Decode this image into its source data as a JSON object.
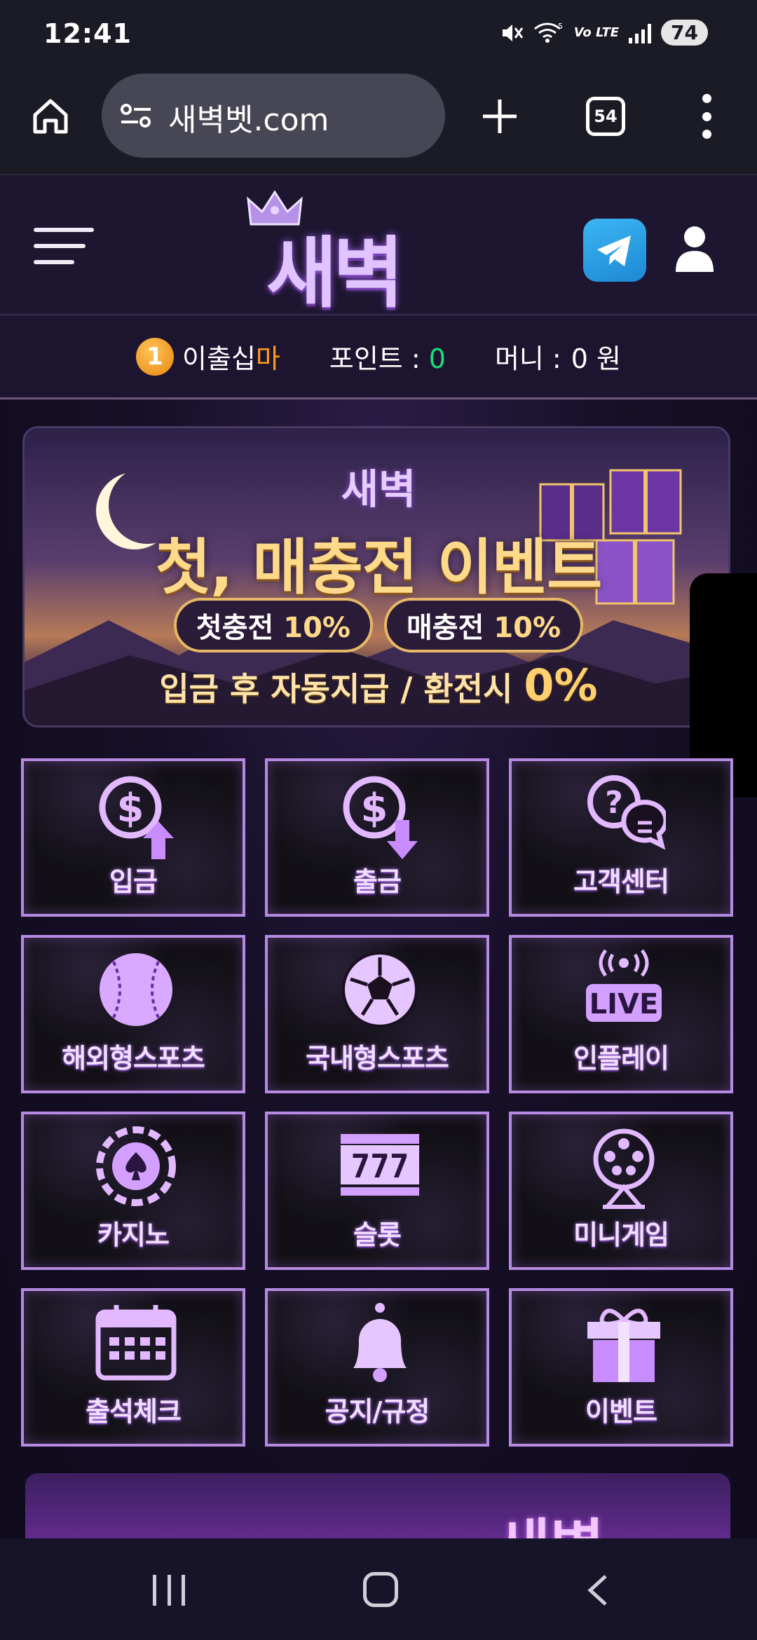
{
  "status_bar": {
    "time": "12:41",
    "wifi_label": "5",
    "volte_label": "Vo LTE",
    "battery": "74",
    "icons": [
      "mute-icon",
      "wifi-icon",
      "volte-icon",
      "signal-icon",
      "battery-icon"
    ]
  },
  "browser": {
    "url": "새벽벳.com",
    "tab_count": "54",
    "icons": [
      "home-icon",
      "site-settings-icon",
      "plus-icon",
      "tabs-icon",
      "more-icon"
    ]
  },
  "site_header": {
    "logo_text": "새벽",
    "icons": [
      "menu-icon",
      "crown-icon",
      "telegram-icon",
      "user-icon"
    ]
  },
  "user_info": {
    "level": "1",
    "nickname_part1": "이출십",
    "nickname_part2": "마",
    "points_label": "포인트 :",
    "points_value": "0",
    "money_label": "머니 :",
    "money_value": "0 원"
  },
  "banner": {
    "brand": "새벽",
    "title": "첫, 매충전 이벤트",
    "pill1_label": "첫충전",
    "pill1_value": "10%",
    "pill2_label": "매충전",
    "pill2_value": "10%",
    "subtitle": "입금 후 자동지급 / 환전시",
    "subtitle_value": "0%"
  },
  "menu": [
    {
      "label": "입금",
      "icon": "deposit-icon"
    },
    {
      "label": "출금",
      "icon": "withdraw-icon"
    },
    {
      "label": "고객센터",
      "icon": "support-chat-icon"
    },
    {
      "label": "해외형스포츠",
      "icon": "baseball-icon"
    },
    {
      "label": "국내형스포츠",
      "icon": "soccer-ball-icon"
    },
    {
      "label": "인플레이",
      "icon": "live-icon"
    },
    {
      "label": "카지노",
      "icon": "casino-chip-icon"
    },
    {
      "label": "슬롯",
      "icon": "slot-machine-icon"
    },
    {
      "label": "미니게임",
      "icon": "lottery-wheel-icon"
    },
    {
      "label": "출석체크",
      "icon": "calendar-icon"
    },
    {
      "label": "공지/규정",
      "icon": "bell-icon"
    },
    {
      "label": "이벤트",
      "icon": "gift-icon"
    }
  ],
  "live_badge": "LIVE",
  "slot_digits": "777",
  "promo_peek_text": "새벽",
  "colors": {
    "accent_purple": "#b58ae0",
    "level_orange": "#ff9a1f",
    "points_green": "#18e07a",
    "banner_gold": "#ffd98a"
  },
  "nav": {
    "icons": [
      "recent-apps-icon",
      "home-nav-icon",
      "back-icon"
    ]
  }
}
